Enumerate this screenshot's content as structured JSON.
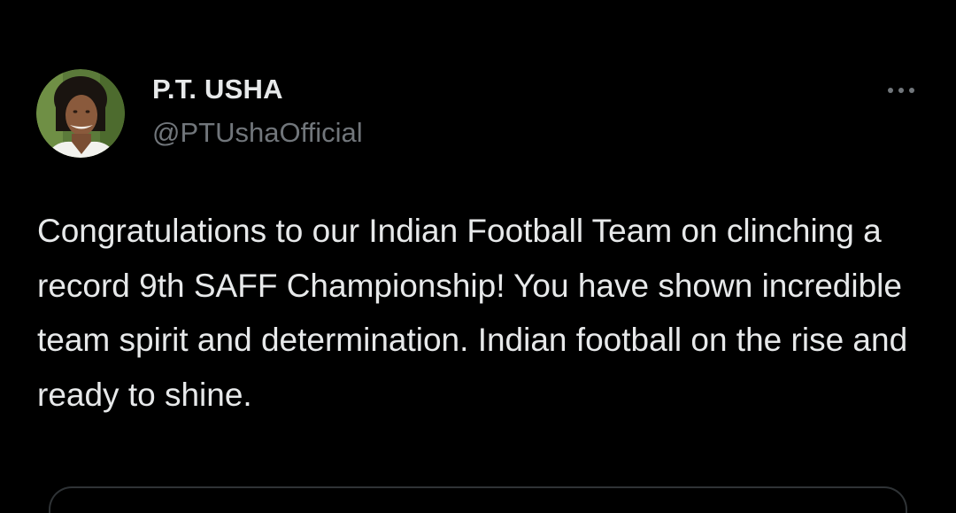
{
  "tweet": {
    "author": {
      "display_name": "P.T. USHA",
      "handle": "@PTUshaOfficial",
      "avatar_icon": "profile-photo"
    },
    "more_icon": "more-options-icon",
    "text": "Congratulations to our Indian Football Team on clinching a record 9th SAFF Championship! You have shown incredible team spirit and determination. Indian football on the rise and ready to shine."
  },
  "colors": {
    "background": "#000000",
    "primary_text": "#e7e9ea",
    "secondary_text": "#71767b",
    "border": "#2f3336"
  }
}
